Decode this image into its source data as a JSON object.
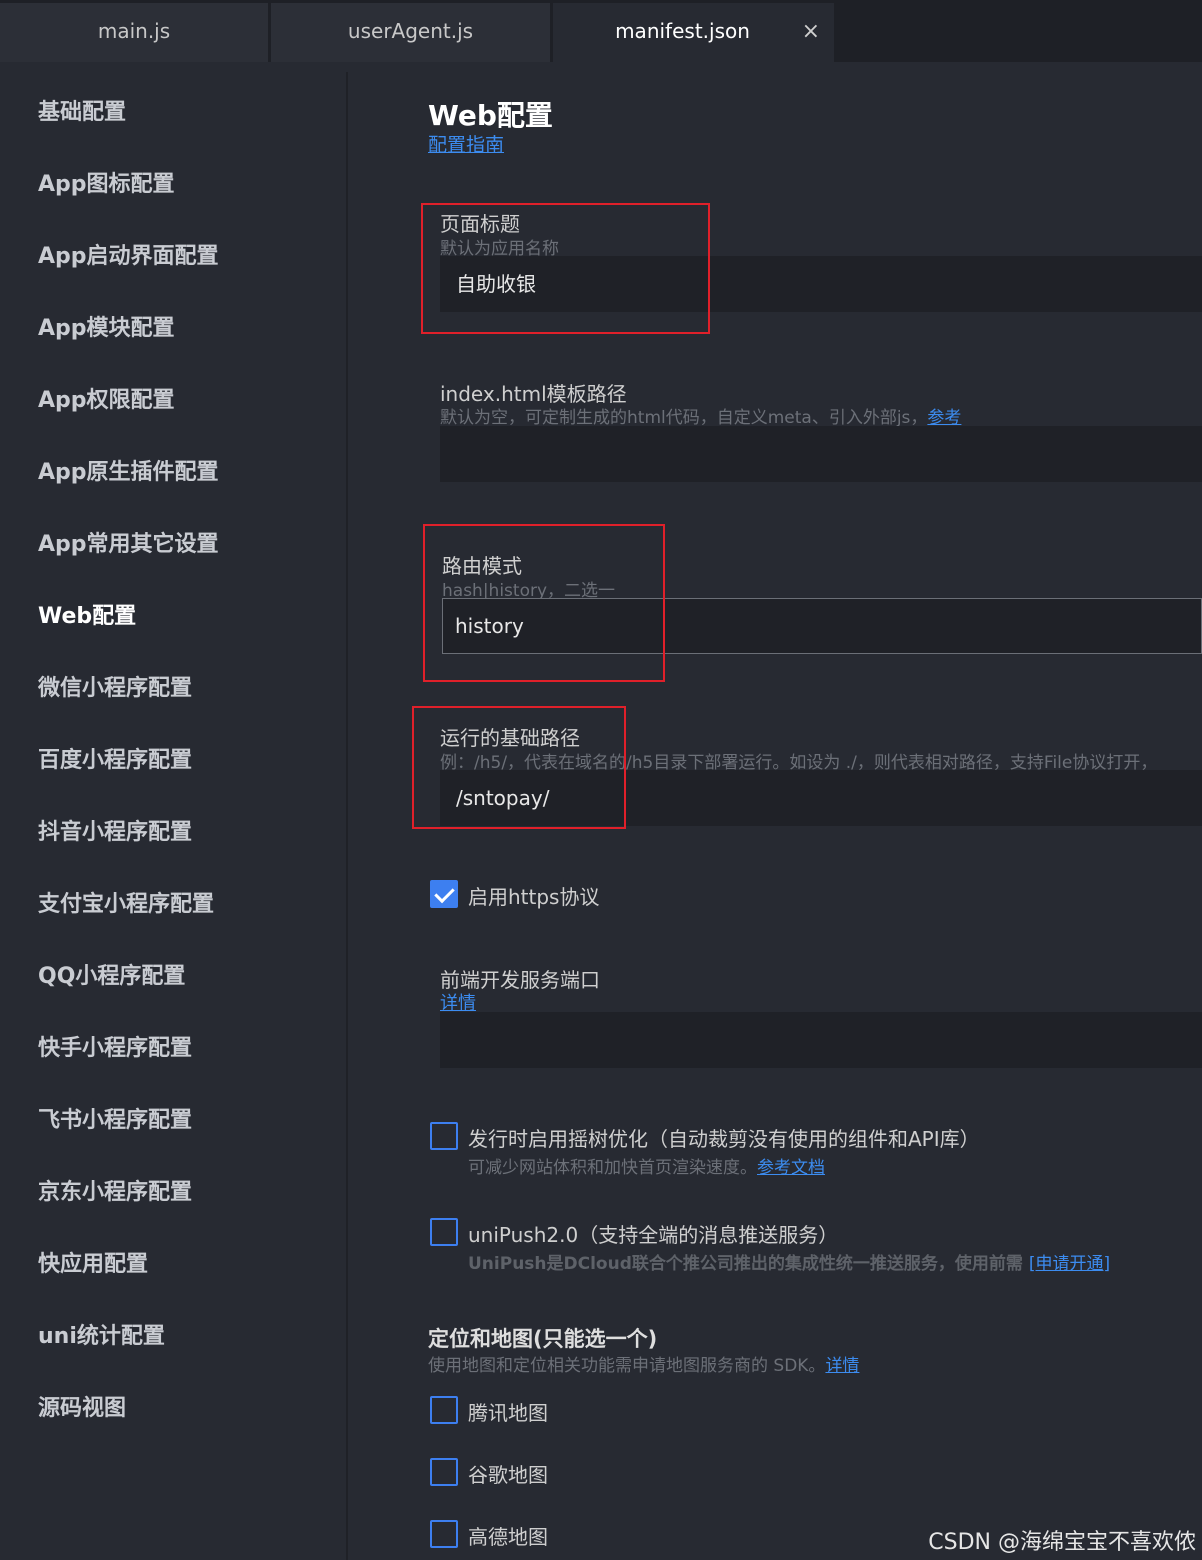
{
  "tabs": [
    {
      "label": "main.js"
    },
    {
      "label": "userAgent.js"
    },
    {
      "label": "manifest.json",
      "close_icon": "×"
    }
  ],
  "sidebar": {
    "items": [
      {
        "label": "基础配置"
      },
      {
        "label": "App图标配置"
      },
      {
        "label": "App启动界面配置"
      },
      {
        "label": "App模块配置"
      },
      {
        "label": "App权限配置"
      },
      {
        "label": "App原生插件配置"
      },
      {
        "label": "App常用其它设置"
      },
      {
        "label": "Web配置"
      },
      {
        "label": "微信小程序配置"
      },
      {
        "label": "百度小程序配置"
      },
      {
        "label": "抖音小程序配置"
      },
      {
        "label": "支付宝小程序配置"
      },
      {
        "label": "QQ小程序配置"
      },
      {
        "label": "快手小程序配置"
      },
      {
        "label": "飞书小程序配置"
      },
      {
        "label": "京东小程序配置"
      },
      {
        "label": "快应用配置"
      },
      {
        "label": "uni统计配置"
      },
      {
        "label": "源码视图"
      }
    ]
  },
  "main": {
    "title": "Web配置",
    "guide_link": "配置指南",
    "page_title": {
      "label": "页面标题",
      "hint": "默认为应用名称",
      "value": "自助收银"
    },
    "template_path": {
      "label": "index.html模板路径",
      "hint": "默认为空，可定制生成的html代码，自定义meta、引入外部js，",
      "hint_link": "参考",
      "value": ""
    },
    "router_mode": {
      "label": "路由模式",
      "hint": "hash|history，二选一",
      "value": "history"
    },
    "base_path": {
      "label": "运行的基础路径",
      "hint": "例：/h5/，代表在域名的/h5目录下部署运行。如设为 ./，则代表相对路径，支持File协议打开，",
      "value": "/sntopay/"
    },
    "https": {
      "label": "启用https协议",
      "checked": true
    },
    "dev_port": {
      "label": "前端开发服务端口",
      "link": "详情",
      "value": ""
    },
    "tree_shaking": {
      "label": "发行时启用摇树优化（自动裁剪没有使用的组件和API库）",
      "hint": "可减少网站体积和加快首页渲染速度。",
      "hint_link": "参考文档",
      "checked": false
    },
    "unipush": {
      "label": "uniPush2.0（支持全端的消息推送服务）",
      "hint": "UniPush是DCloud联合个推公司推出的集成性统一推送服务，使用前需 ",
      "hint_link": "[申请开通]",
      "checked": false
    },
    "maps": {
      "title": "定位和地图(只能选一个)",
      "hint": "使用地图和定位相关功能需申请地图服务商的 SDK。",
      "hint_link": "详情",
      "options": [
        {
          "label": "腾讯地图",
          "checked": false
        },
        {
          "label": "谷歌地图",
          "checked": false
        },
        {
          "label": "高德地图",
          "checked": false
        }
      ]
    }
  },
  "watermark": "CSDN @海绵宝宝不喜欢侬",
  "colors": {
    "accent": "#3d7ff0",
    "highlight_box": "#e0202a",
    "link": "#3c8cf0"
  }
}
